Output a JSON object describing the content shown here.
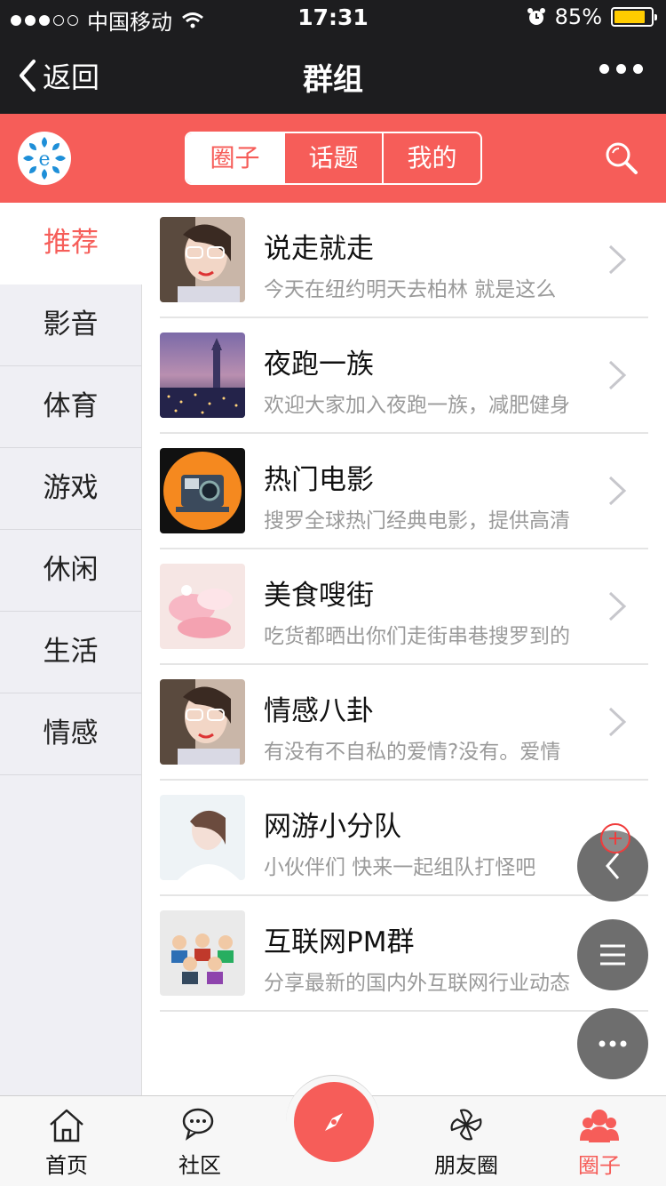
{
  "status_bar": {
    "carrier": "中国移动",
    "time": "17:31",
    "battery": "85%",
    "battery_level": 0.85
  },
  "nav": {
    "back_label": "返回",
    "title": "群组"
  },
  "segments": [
    {
      "label": "圈子",
      "active": true
    },
    {
      "label": "话题",
      "active": false
    },
    {
      "label": "我的",
      "active": false
    }
  ],
  "sidebar": {
    "items": [
      {
        "label": "推荐",
        "active": true
      },
      {
        "label": "影音"
      },
      {
        "label": "体育"
      },
      {
        "label": "游戏"
      },
      {
        "label": "休闲"
      },
      {
        "label": "生活"
      },
      {
        "label": "情感"
      }
    ]
  },
  "groups": [
    {
      "name": "说走就走",
      "desc": "今天在纽约明天去柏林 就是这么"
    },
    {
      "name": "夜跑一族",
      "desc": "欢迎大家加入夜跑一族，减肥健身"
    },
    {
      "name": "热门电影",
      "desc": "搜罗全球热门经典电影，提供高清"
    },
    {
      "name": "美食嗖街",
      "desc": "吃货都晒出你们走街串巷搜罗到的"
    },
    {
      "name": "情感八卦",
      "desc": "有没有不自私的爱情?没有。爱情"
    },
    {
      "name": "网游小分队",
      "desc": "小伙伴们 快来一起组队打怪吧"
    },
    {
      "name": "互联网PM群",
      "desc": "分享最新的国内外互联网行业动态"
    }
  ],
  "tabbar": {
    "home": "首页",
    "community": "社区",
    "moments": "朋友圈",
    "circles": "圈子"
  },
  "colors": {
    "accent": "#f65d59",
    "dark_bar": "#1d1d1f",
    "battery": "#ffcc00"
  }
}
